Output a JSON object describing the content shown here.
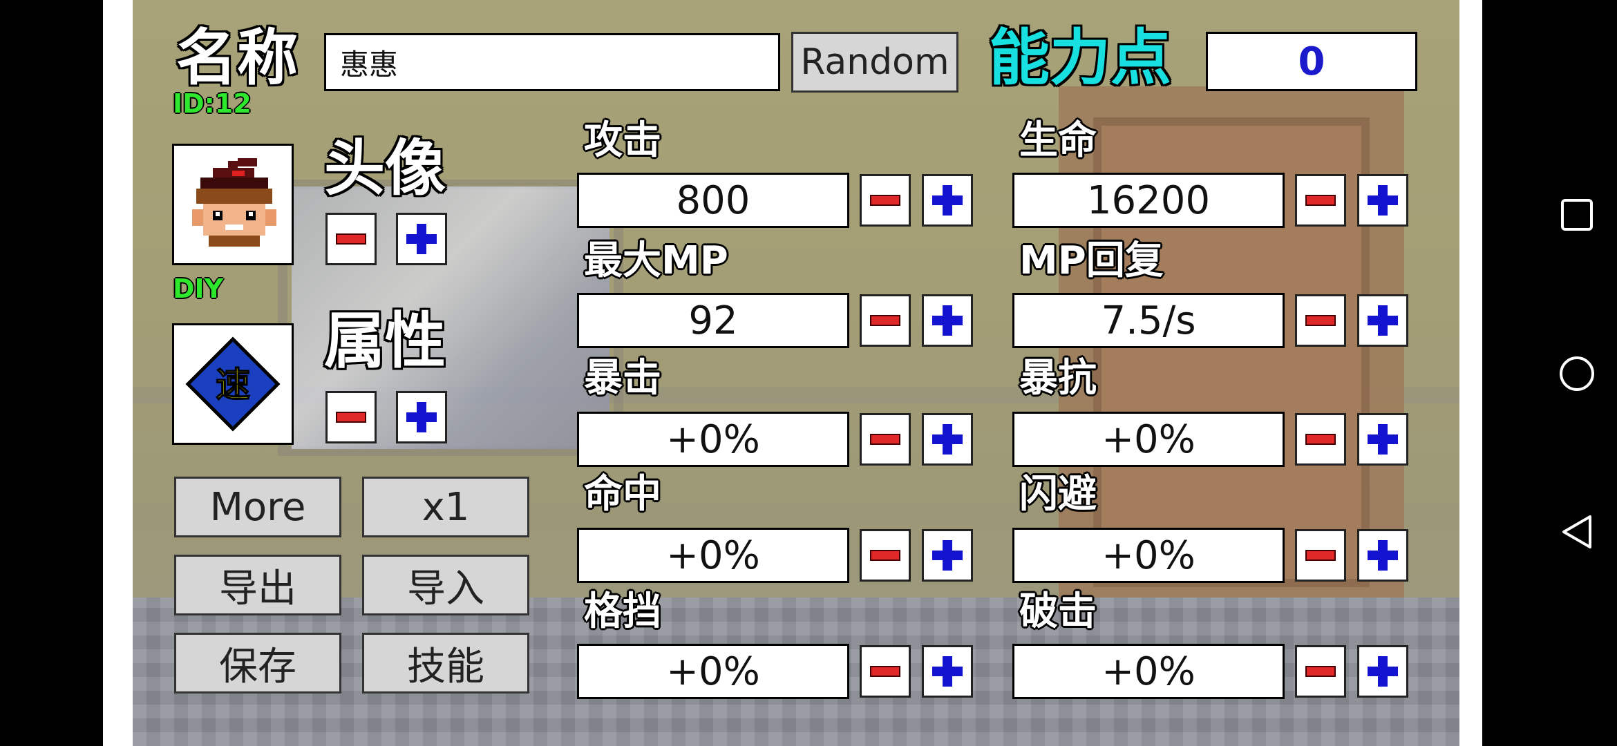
{
  "name_label": "名称",
  "name_value": "惠惠",
  "random_button": "Random",
  "ability_points_label": "能力点",
  "ability_points_value": "0",
  "id_text": "ID:12",
  "avatar_label": "头像",
  "diy_text": "DIY",
  "attribute_label": "属性",
  "attribute_char": "速",
  "left_buttons": {
    "more": "More",
    "multiplier": "x1",
    "export": "导出",
    "import": "导入",
    "save": "保存",
    "skills": "技能"
  },
  "stats": {
    "attack": {
      "label": "攻击",
      "value": "800"
    },
    "hp": {
      "label": "生命",
      "value": "16200"
    },
    "max_mp": {
      "label": "最大MP",
      "value": "92"
    },
    "mp_regen": {
      "label": "MP回复",
      "value": "7.5/s"
    },
    "crit": {
      "label": "暴击",
      "value": "+0%"
    },
    "crit_resist": {
      "label": "暴抗",
      "value": "+0%"
    },
    "hit": {
      "label": "命中",
      "value": "+0%"
    },
    "dodge": {
      "label": "闪避",
      "value": "+0%"
    },
    "block": {
      "label": "格挡",
      "value": "+0%"
    },
    "break": {
      "label": "破击",
      "value": "+0%"
    }
  },
  "colors": {
    "ability_label": "#19e0e0",
    "ability_value": "#1a1acc",
    "id_green": "#2ee82e",
    "minus_red": "#e02828",
    "plus_blue": "#1414d0",
    "attribute_diamond": "#1a3fbf",
    "attribute_char": "#ffff00"
  },
  "nav_icons": [
    "recent-apps-icon",
    "home-icon",
    "back-icon"
  ]
}
